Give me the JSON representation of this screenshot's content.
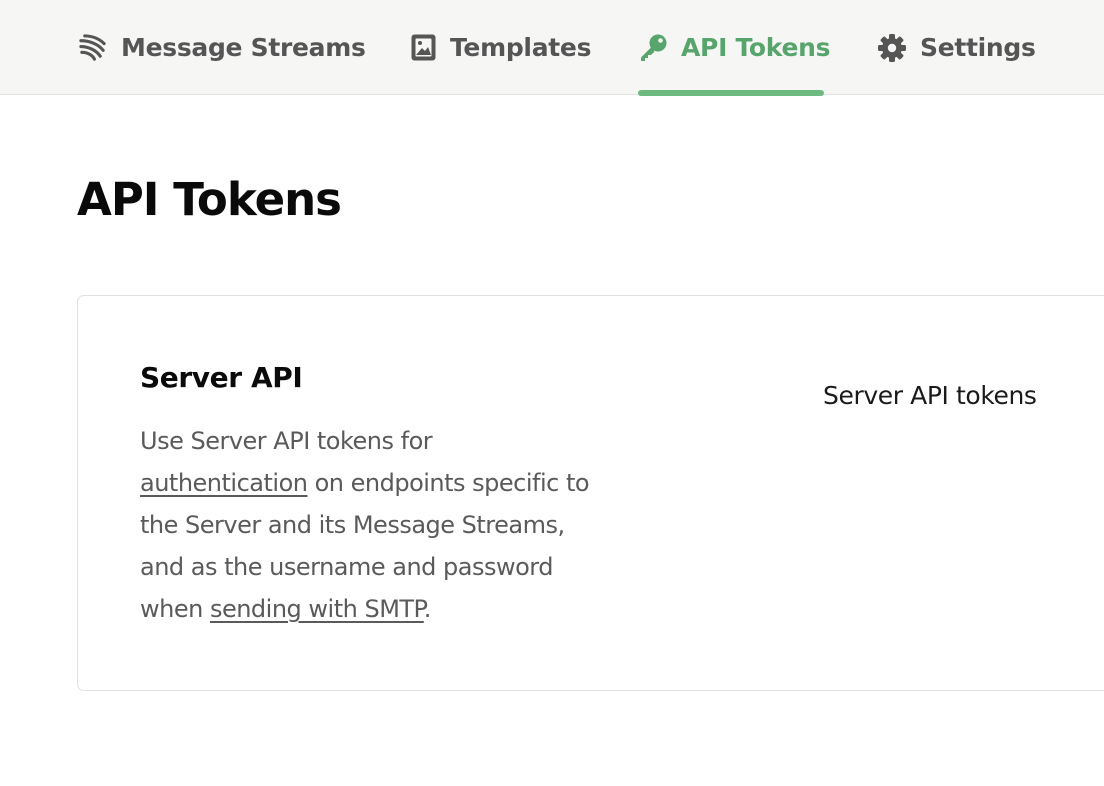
{
  "nav": {
    "tabs": [
      {
        "label": "Message Streams",
        "icon": "message-streams-icon",
        "active": false
      },
      {
        "label": "Templates",
        "icon": "templates-icon",
        "active": false
      },
      {
        "label": "API Tokens",
        "icon": "key-icon",
        "active": true
      },
      {
        "label": "Settings",
        "icon": "gear-icon",
        "active": false
      }
    ],
    "active_color": "#57a56c",
    "inactive_color": "#555555"
  },
  "page": {
    "title": "API Tokens"
  },
  "card": {
    "title": "Server API",
    "description": {
      "line1": "Use Server API tokens for",
      "link_authentication": "authentication",
      "line2_rest": " on endpoints specific to",
      "line3": "the Server and its Message Streams,",
      "line4": "and as the username and password",
      "line5_start": "when ",
      "link_smtp": "sending with SMTP",
      "line5_end": "."
    },
    "right_label": "Server API tokens"
  }
}
